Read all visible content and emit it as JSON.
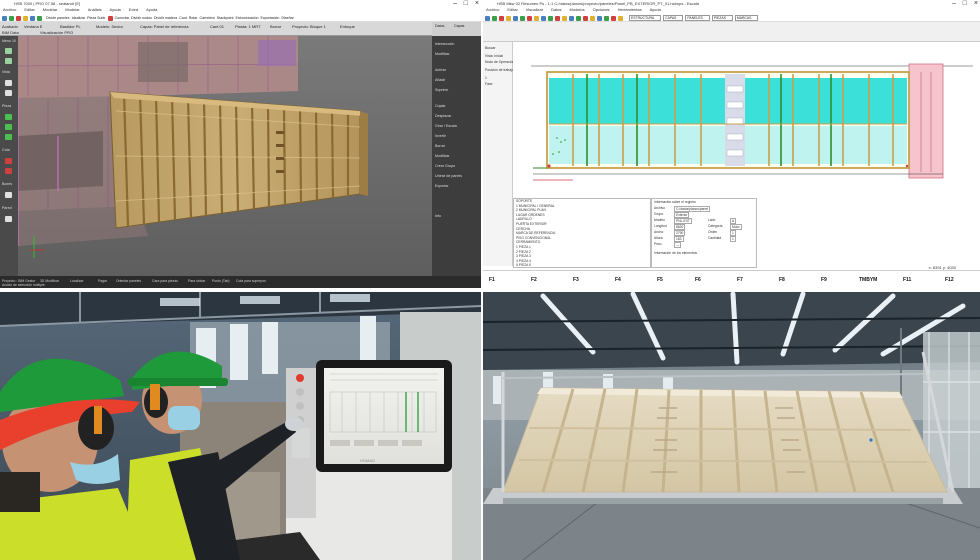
{
  "q1_cad3d": {
    "title": "HSB 7000 | PRO 07.58 - sealandr [E]",
    "menu": [
      "Archivo",
      "Editar",
      "Modelar",
      "Modelar",
      "Análisis",
      "Ayuda",
      "Extra",
      "Ayuda"
    ],
    "toolbar_labels": [
      "Dividir paneles",
      "Idealizar",
      "Pieza Subir",
      "Conectar",
      "Dividir nodos",
      "Dividir madera",
      "Cant. Rotar",
      "Carretera",
      "Stackpoint",
      "Estructuración",
      "Exportación",
      "Diseñar"
    ],
    "subbar_labels": [
      "Acabado",
      "Ventana E",
      "Bastidor PL",
      "Modelo: Sector",
      "Capas: Panel de referencia",
      "Cant 01",
      "Planta: 1 MRT",
      "Borrar",
      "Proyecto: Bloque 1",
      "Enfoque",
      "BIM Data",
      "Visualización PRO"
    ],
    "left_tools": [
      "Menu 10",
      "Vista",
      "Pieza",
      "Cota",
      "Boxes",
      "Pared"
    ],
    "right_panel_head": [
      "Datos",
      "Capas"
    ],
    "right_panel": [
      "Intersección",
      "Modificar",
      "Activar",
      "Añadir",
      "Suprimir",
      "Copiar",
      "Desplazar",
      "Girar / Escala",
      "Invertir",
      "Borrar",
      "Modificar",
      "Crear Grupo",
      "Unirse de panels",
      "Exportar",
      "Info"
    ],
    "status": [
      "Proyecto : BIM Gestor",
      "3D Modificar",
      "Localizar",
      "Pagar",
      "Orientar paneles",
      "Cara para piezas",
      "Para ubicar",
      "Punto (Tab)",
      "Cota para superpon"
    ],
    "status2": "Acción de selección múltiple",
    "colors": {
      "panel_wood": "#c8a86a",
      "stud": "#a98648",
      "building": "#b38a8a",
      "pink_edge": "#d070c0"
    }
  },
  "q2_cad2d": {
    "title": "HSB Mkw 02 Resumen Ps - 1:1 C:/datos/planos/proyecto/paneles/Panel_PB_EXTERIOR_PT_01.hsbnps - Escala",
    "menu": [
      "Archivo",
      "Editar",
      "Visualizar",
      "Datos",
      "Modelos",
      "Opciones",
      "Herramientas",
      "Ayuda"
    ],
    "selectors": [
      "ESTRUCTURA",
      "CAPAS",
      "PANELES",
      "PIEZAS",
      "MARCAS"
    ],
    "left_list": [
      "Buscar",
      "Vista: Inicial",
      "Nodo de Operación",
      "Posición de trabajo",
      "1",
      "Fase"
    ],
    "info_lines": [
      "SOPORTE",
      "1  MUNICIPAL / GENERAL",
      "2  MUNICIPAL PLAN",
      "LUGAR ORDENES",
      "LADRILLO",
      "PUERTA EXTERIOR",
      "CERCHA",
      "MARCA DE REFERENCIA",
      "  PISO CONVENCIONAL",
      "  CERRAMIENTO",
      "1  PIEZA 1",
      "2  PIEZA 2",
      "3  PIEZA 3",
      "4  PIEZA 4",
      "5  PIEZA 5",
      "6  PIEZA 6",
      "7  PIEZA 7",
      "8  PIEZA 8",
      "9  PIEZA 9",
      "PROYECTO"
    ],
    "data_head": "Información sobre el registro",
    "data_fields": [
      {
        "k": "Archivo",
        "v": "C:/datos/planos/panel"
      },
      {
        "k": "Grupo",
        "v": "Exterior"
      },
      {
        "k": "Modelo",
        "v": "PNL-EXT"
      },
      {
        "k": "Longitud",
        "v": "8620"
      },
      {
        "k": "Ancho",
        "v": "2790"
      },
      {
        "k": "Altura",
        "v": "163"
      },
      {
        "k": "Peso",
        "v": "—"
      }
    ],
    "data_fields_right": [
      {
        "k": "Lado",
        "v": "A"
      },
      {
        "k": "Categoría",
        "v": "Muro"
      },
      {
        "k": "Orden",
        "v": "1"
      },
      {
        "k": "Cantidad",
        "v": "1"
      }
    ],
    "data_foot": "Información de los elementos",
    "function_keys": [
      "F1",
      "F2",
      "F3",
      "F4",
      "F5",
      "F6",
      "F7",
      "F8",
      "F9",
      "F10",
      "F11",
      "F12"
    ],
    "function_extras": [
      "Stitch",
      "TMBYM"
    ],
    "coordinates": "x: 8391 y: 4030",
    "colors": {
      "cyan_fill": "#36e0d6",
      "frame": "#c8a04a",
      "stud_green": "#2b8f2b",
      "pink_end": "#f5c0c8"
    }
  },
  "q3_photo": {
    "monitor_brand": "HOMAG"
  },
  "q4_photo": {},
  "colors": {
    "helmet": "#1f9a3a",
    "vest": "#d6e82a",
    "sky_light": "#eaf1f6",
    "floor": "#7c8489"
  }
}
